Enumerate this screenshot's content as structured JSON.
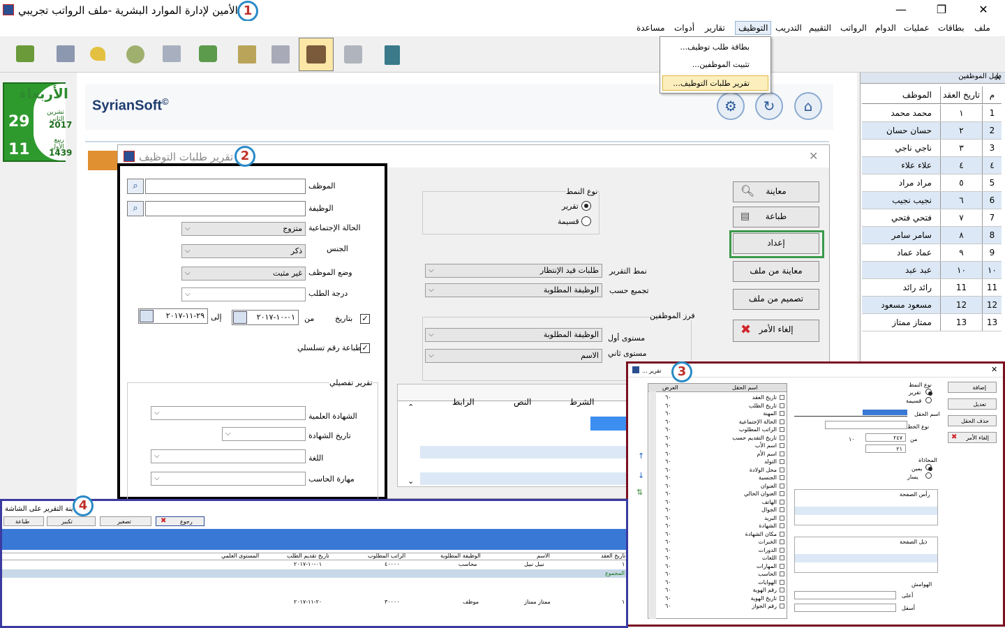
{
  "window": {
    "title": "الأمين لإدارة الموارد البشرية -ملف الرواتب تجريبي",
    "minimize": "—",
    "maximize": "❐",
    "close": "✕"
  },
  "menu": {
    "items": [
      "ملف",
      "بطاقات",
      "عمليات",
      "الدوام",
      "الرواتب",
      "التقييم",
      "التدريب",
      "التوظيف",
      "تقارير",
      "أدوات",
      "مساعدة"
    ]
  },
  "dropdown": {
    "items": [
      "بطاقة طلب توظيف...",
      "تثبيت الموظفين...",
      "تقرير طلبات التوظيف..."
    ]
  },
  "toolbar": {
    "icons": [
      "open-folder-icon",
      "employee-card-icon",
      "pin-icon",
      "clock-icon",
      "attendance-icon",
      "payroll-icon",
      "books-icon",
      "files-icon",
      "employees-icon",
      "calculator-icon",
      "exit-door-icon"
    ],
    "selected_index": 8
  },
  "badges": {
    "b1": "1",
    "b2": "2",
    "b3": "3",
    "b4": "4"
  },
  "calendar": {
    "weekday": "الأربعاء",
    "greg_day": "29",
    "greg_month": "تشرين الثاني",
    "greg_year": "2017",
    "hijri_day": "11",
    "hijri_month": "ربيع الأول",
    "hijri_year": "1439"
  },
  "logo": {
    "text": "SyrianSoft",
    "mark": "©"
  },
  "right_panel": {
    "title": "دليل الموظفين",
    "close": "×",
    "headers": {
      "num": "م",
      "contract": "تاريخ العقد",
      "employee": "الموظف"
    },
    "rows": [
      {
        "n": "1",
        "c": "١",
        "e": "محمد محمد"
      },
      {
        "n": "2",
        "c": "٢",
        "e": "حسان حسان"
      },
      {
        "n": "3",
        "c": "٣",
        "e": "ناجي ناجي"
      },
      {
        "n": "٤",
        "c": "٤",
        "e": "علاء علاء"
      },
      {
        "n": "5",
        "c": "٥",
        "e": "مراد مراد"
      },
      {
        "n": "6",
        "c": "٦",
        "e": "نجيب نجيب"
      },
      {
        "n": "7",
        "c": "٧",
        "e": "فتحي فتحي"
      },
      {
        "n": "8",
        "c": "٨",
        "e": "سامر سامر"
      },
      {
        "n": "9",
        "c": "٩",
        "e": "عماد عماد"
      },
      {
        "n": "١٠",
        "c": "١٠",
        "e": "عبد عبد"
      },
      {
        "n": "11",
        "c": "11",
        "e": "رائد رائد"
      },
      {
        "n": "12",
        "c": "12",
        "e": "مسعود مسعود"
      },
      {
        "n": "13",
        "c": "13",
        "e": "ممتاز ممتاز"
      }
    ]
  },
  "dialog": {
    "title": "تقرير طلبات التوظيف",
    "close": "✕",
    "filters": {
      "employee": "الموظف",
      "job": "الوظيفة",
      "marital": "الحالة الإجتماعية",
      "marital_value": "متزوج",
      "gender": "الجنس",
      "gender_value": "ذكر",
      "status": "وضع الموظف",
      "status_value": "غير مثبت",
      "degree": "درجة الطلب",
      "by_date": "بتاريخ",
      "from": "من",
      "from_value": "٠١-١٠-٢٠١٧",
      "to": "إلى",
      "to_value": "٢٩-١١-٢٠١٧",
      "serial": "طباعة رقم تسلسلي",
      "detail_title": "تقرير تفصيلي",
      "certificate": "الشهادة العلمية",
      "cert_date": "تاريخ الشهادة",
      "language": "اللغة",
      "computer": "مهارة الحاسب"
    },
    "style": {
      "title": "نوع النمط",
      "report": "تقرير",
      "card": "قسيمة"
    },
    "report_style_label": "نمط التقرير",
    "report_style_value": "طلبات قيد الإنتظار",
    "group_by_label": "تجميع حسب",
    "group_by_value": "الوظيفة المطلوبة",
    "sort": {
      "title": "فرز الموظفين",
      "level1": "مستوى أول",
      "level1_value": "الوظيفة المطلوبة",
      "level2": "مستوى ثاني",
      "level2_value": "الاسم"
    },
    "grid": {
      "headers": [
        "الشرط",
        "النص",
        "الرابط"
      ]
    },
    "buttons": {
      "preview": "معاينة",
      "print": "طباعة",
      "setup": "إعداد",
      "preview_file": "معاينة من ملف",
      "design_file": "تصميم من ملف",
      "cancel": "إلغاء الأمر"
    }
  },
  "inset3": {
    "title": "تقرير ...",
    "headers": {
      "field": "اسم الحقل",
      "width": "العرض"
    },
    "rows": [
      [
        "تاريخ العقد",
        "٦٠"
      ],
      [
        "تاريخ الطلب",
        "٦٠"
      ],
      [
        "المهنة",
        "٦٠"
      ],
      [
        "الحالة الإجتماعية",
        "٦٠"
      ],
      [
        "الراتب المطلوب",
        "٦٠"
      ],
      [
        "تاريخ التقديم حسب",
        "٦٠"
      ],
      [
        "اسم الأب",
        "٦٠"
      ],
      [
        "اسم الأم",
        "٦٠"
      ],
      [
        "التولد",
        "٦٠"
      ],
      [
        "محل الولادة",
        "٦٠"
      ],
      [
        "الجنسية",
        "٦٠"
      ],
      [
        "العنوان",
        "٦٠"
      ],
      [
        "العنوان الحالي",
        "٦٠"
      ],
      [
        "الهاتف",
        "٦٠"
      ],
      [
        "الجوال",
        "٦٠"
      ],
      [
        "البريد",
        "٦٠"
      ],
      [
        "الشهادة",
        "٦٠"
      ],
      [
        "مكان الشهادة",
        "٦٠"
      ],
      [
        "الخبرات",
        "٦٠"
      ],
      [
        "الدورات",
        "٦٠"
      ],
      [
        "اللغات",
        "٦٠"
      ],
      [
        "المهارات",
        "٦٠"
      ],
      [
        "الحاسب",
        "٦٠"
      ],
      [
        "الهوايات",
        "٦٠"
      ],
      [
        "رقم الهوية",
        "٦٠"
      ],
      [
        "تاريخ الهوية",
        "٦٠"
      ],
      [
        "رقم الجواز",
        "٦٠"
      ]
    ],
    "style_title": "نوع النمط",
    "style_a": "تقرير",
    "style_b": "قسيمة",
    "field_name_label": "اسم الحقل",
    "line_label": "نوع الخط",
    "from_label": "من",
    "from_value": "٢٤٧",
    "to_value": "٢١",
    "w_value": "١٠",
    "alignment": "المحاذاة",
    "align_a": "يمين",
    "align_b": "يسار",
    "header_label": "رأس الصفحة",
    "footer_label": "ذيل الصفحة",
    "margins_label": "الهوامش",
    "top_label": "أعلى",
    "bottom_label": "أسفل",
    "buttons": [
      "إضافة",
      "تعديل",
      "حذف الحقل",
      "إلغاء الأمر"
    ]
  },
  "inset4": {
    "title": "معاينة التقرير على الشاشة",
    "buttons": [
      "طباعة",
      "تكبير",
      "تصغير",
      "رجوع"
    ],
    "headers": [
      "تاريخ العقد",
      "الاسم",
      "الوظيفة المطلوبة",
      "الراتب المطلوب",
      "تاريخ تقديم الطلب",
      "المستوى العلمي"
    ],
    "row1": [
      "١",
      "نبيل نبيل",
      "محاسب",
      "٤٠٠٠٠",
      "٠١-١٠-٢٠١٧",
      ""
    ],
    "group": "المجموع",
    "row2": [
      "١",
      "ممتاز ممتاز",
      "موظف",
      "٣٠٠٠٠",
      "٢٠-١١-٢٠١٧",
      ""
    ]
  }
}
